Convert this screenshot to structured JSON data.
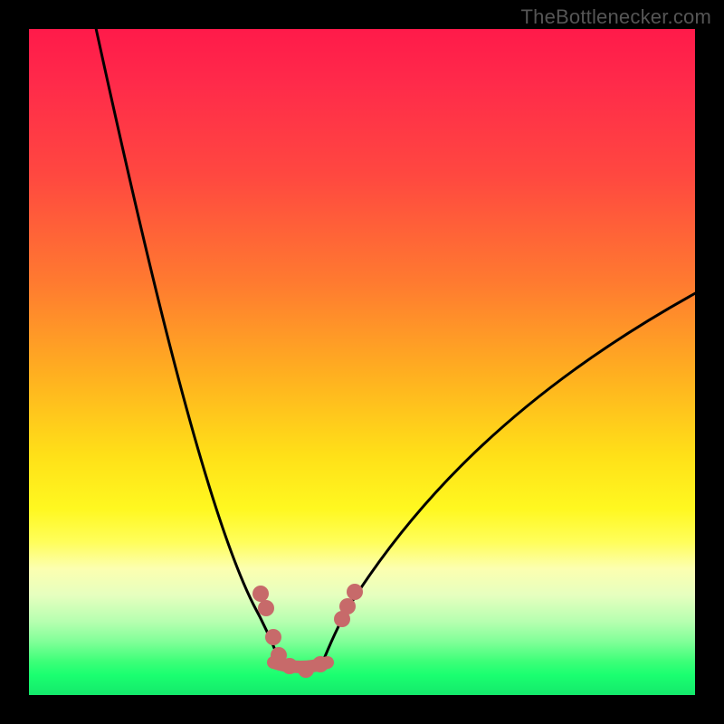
{
  "attribution": "TheBottlenecker.com",
  "chart_data": {
    "type": "line",
    "title": "",
    "xlabel": "",
    "ylabel": "",
    "ylim": [
      0,
      100
    ],
    "xlim": [
      0,
      100
    ],
    "note": "V-shaped bottleneck curve on a vertical red→green gradient. No numeric axes or tick labels are visible; values below are positional estimates (percent of plot width/height, y=0 at top).",
    "series": [
      {
        "name": "curve-left-branch",
        "x": [
          10,
          16,
          22,
          28,
          33,
          36,
          38
        ],
        "y": [
          0,
          24,
          52,
          76,
          88,
          92,
          95
        ]
      },
      {
        "name": "curve-bottom",
        "x": [
          38,
          41,
          44
        ],
        "y": [
          95,
          96,
          95
        ]
      },
      {
        "name": "curve-right-branch",
        "x": [
          44,
          48,
          56,
          68,
          84,
          100
        ],
        "y": [
          95,
          88,
          76,
          62,
          48,
          40
        ]
      },
      {
        "name": "highlight-markers",
        "x": [
          35,
          36,
          37,
          38,
          39,
          41,
          44,
          47,
          48,
          49
        ],
        "y": [
          85,
          87,
          91,
          94,
          96,
          96,
          95,
          89,
          87,
          85
        ],
        "style": "salmon-dots"
      }
    ],
    "background_gradient_stops": [
      {
        "pos": 0.0,
        "color": "#ff1a4a"
      },
      {
        "pos": 0.5,
        "color": "#ffb020"
      },
      {
        "pos": 0.75,
        "color": "#fff820"
      },
      {
        "pos": 0.9,
        "color": "#80ff98"
      },
      {
        "pos": 1.0,
        "color": "#14e86b"
      }
    ]
  }
}
